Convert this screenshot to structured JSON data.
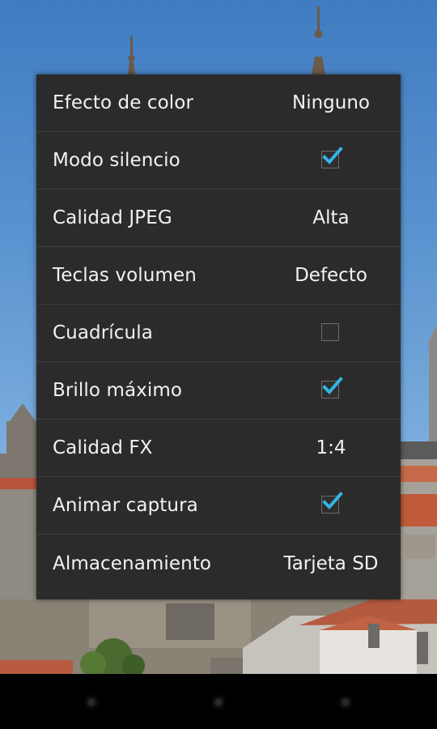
{
  "settings": {
    "items": [
      {
        "label": "Efecto de color",
        "value": "Ninguno",
        "checked": null
      },
      {
        "label": "Modo silencio",
        "value": null,
        "checked": true
      },
      {
        "label": "Calidad JPEG",
        "value": "Alta",
        "checked": null
      },
      {
        "label": "Teclas volumen",
        "value": "Defecto",
        "checked": null
      },
      {
        "label": "Cuadrícula",
        "value": null,
        "checked": false
      },
      {
        "label": "Brillo máximo",
        "value": null,
        "checked": true
      },
      {
        "label": "Calidad FX",
        "value": "1:4",
        "checked": null
      },
      {
        "label": "Animar captura",
        "value": null,
        "checked": true
      },
      {
        "label": "Almacenamiento",
        "value": "Tarjeta SD",
        "checked": null
      }
    ]
  },
  "colors": {
    "panel_bg": "#2b2b2b",
    "divider": "#3e3e3e",
    "text": "#f2f2f2",
    "check_accent": "#33b5e5"
  },
  "nav_bar": {
    "buttons": [
      "back-button",
      "home-button",
      "recents-button"
    ]
  }
}
